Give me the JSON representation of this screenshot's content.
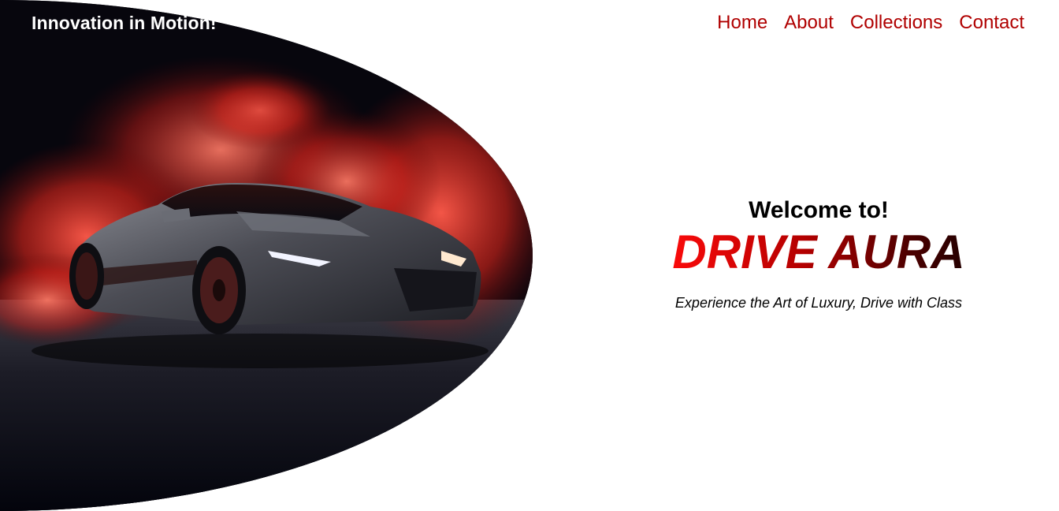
{
  "header": {
    "tagline": "Innovation in Motion!",
    "nav": [
      {
        "label": "Home"
      },
      {
        "label": "About"
      },
      {
        "label": "Collections"
      },
      {
        "label": "Contact"
      }
    ]
  },
  "hero": {
    "welcome": "Welcome to!",
    "brand_name": "DRIVE AURA",
    "subtitle": "Experience the Art of Luxury, Drive with Class",
    "image_subject": "sports-car-in-red-smoke"
  },
  "colors": {
    "nav_link": "#b00000",
    "brand_gradient_start": "#ff0b0b",
    "brand_gradient_end": "#1c0000",
    "text": "#000000",
    "background": "#ffffff"
  }
}
